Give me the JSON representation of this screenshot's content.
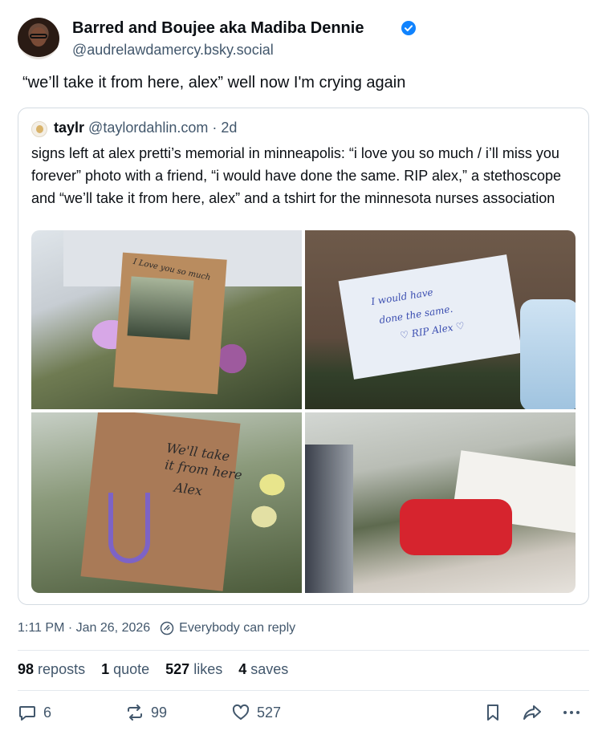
{
  "author": {
    "display_name": "Barred and Boujee aka Madiba Dennie",
    "handle": "@audrelawdamercy.bsky.social",
    "verified": true
  },
  "post_text": "“we’ll take it from here, alex” well now I'm crying again",
  "quote": {
    "author_name": "taylr",
    "author_handle": "@taylordahlin.com",
    "separator": "·",
    "time_ago": "2d",
    "text": "signs left at alex pretti’s memorial in minneapolis: “i love you so much / i’ll miss you forever” photo with a friend, “i would have done the same. RIP alex,” a stethoscope and “we’ll take it from here, alex” and a tshirt for the minnesota nurses association",
    "images": {
      "img1_sign_text": "I Love you so much",
      "img2_card_line1": "I would have",
      "img2_card_line2": "done the same.",
      "img2_card_line3": "♡ RIP Alex ♡",
      "img3_sign_line1": "We'll take",
      "img3_sign_line2": "it from here",
      "img3_sign_line3": "Alex"
    }
  },
  "meta": {
    "time": "1:11 PM",
    "separator": "·",
    "date": "Jan 26, 2026",
    "reply_setting": "Everybody can reply"
  },
  "stats": {
    "reposts_count": "98",
    "reposts_label": "reposts",
    "quotes_count": "1",
    "quotes_label": "quote",
    "likes_count": "527",
    "likes_label": "likes",
    "saves_count": "4",
    "saves_label": "saves"
  },
  "actions": {
    "reply_count": "6",
    "repost_count": "99",
    "like_count": "527"
  },
  "colors": {
    "text_primary": "#0b0f14",
    "text_secondary": "#42576c",
    "verified_blue": "#1083fe",
    "border": "#d4dbe2"
  }
}
